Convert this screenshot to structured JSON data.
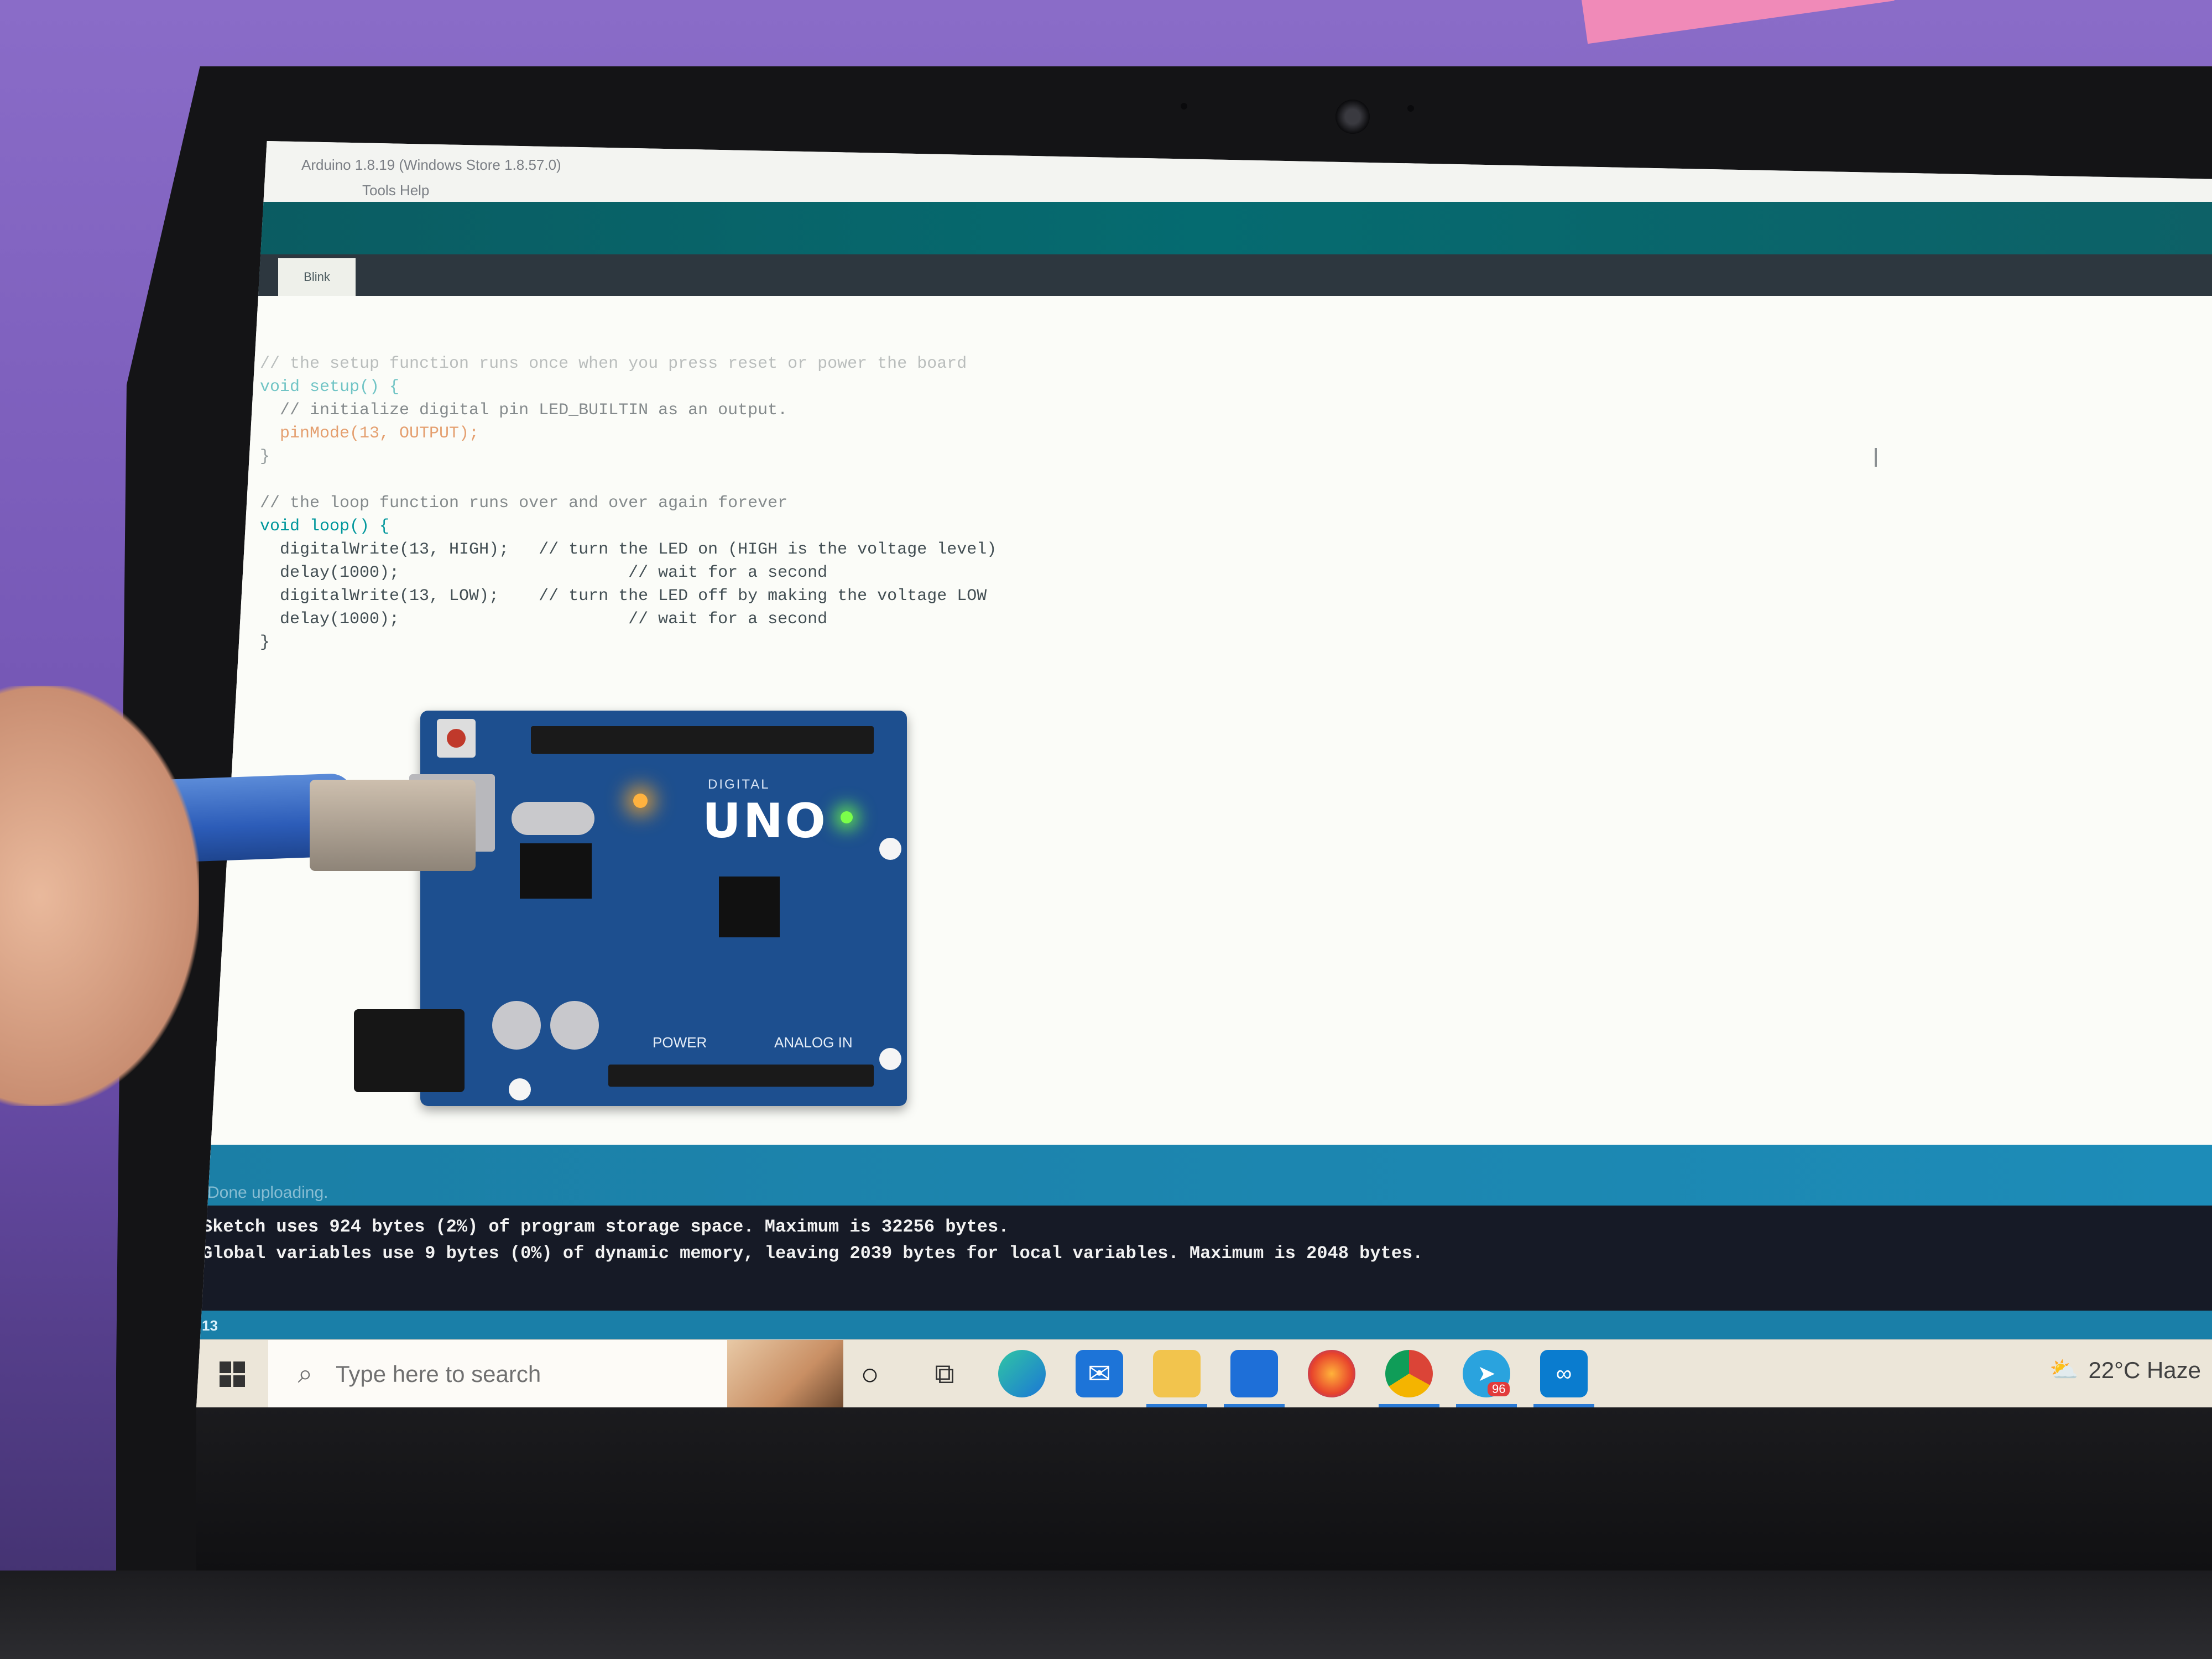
{
  "window": {
    "title": "Arduino 1.8.19 (Windows Store 1.8.57.0)",
    "menu": "Tools  Help"
  },
  "tab": {
    "label": "Blink"
  },
  "editor": {
    "lines": [
      "// the setup function runs once when you press reset or power the board",
      "void setup() {",
      "  // initialize digital pin LED_BUILTIN as an output.",
      "  pinMode(13, OUTPUT);",
      "}",
      "",
      "// the loop function runs over and over again forever",
      "void loop() {",
      "  digitalWrite(13, HIGH);   // turn the LED on (HIGH is the voltage level)",
      "  delay(1000);                       // wait for a second",
      "  digitalWrite(13, LOW);    // turn the LED off by making the voltage LOW",
      "  delay(1000);                       // wait for a second",
      "}"
    ]
  },
  "board": {
    "digital": "DIGITAL",
    "name": "UNO",
    "power": "POWER",
    "analog": "ANALOG IN"
  },
  "status": {
    "message": "Done uploading."
  },
  "console": {
    "line1": "Sketch uses 924 bytes (2%) of program storage space. Maximum is 32256 bytes.",
    "line2": "Global variables use 9 bytes (0%) of dynamic memory, leaving 2039 bytes for local variables. Maximum is 2048 bytes."
  },
  "line_number": "13",
  "taskbar": {
    "search_placeholder": "Type here to search",
    "weather": "22°C  Haze",
    "apps": [
      "cortana",
      "task-view",
      "edge",
      "mail",
      "file-explorer",
      "microsoft-store",
      "firefox",
      "chrome",
      "telegram",
      "arduino-ide"
    ],
    "telegram_badge": "96"
  },
  "colors": {
    "arduino_teal": "#00979c",
    "status_blue": "#1b7fa6",
    "console_bg": "#161a26",
    "board_blue": "#1d4f8f"
  }
}
